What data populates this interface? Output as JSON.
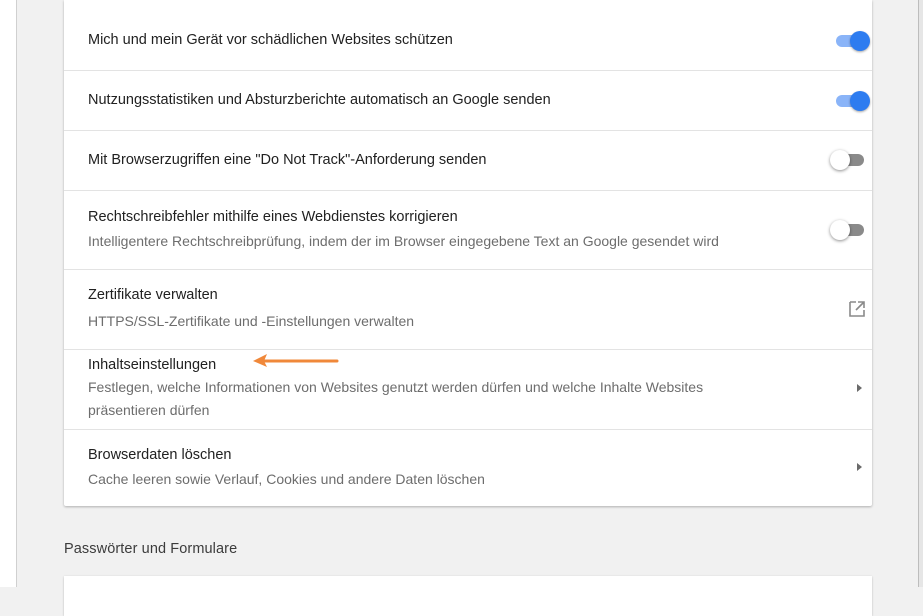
{
  "settings": {
    "rows": [
      {
        "title": "Mich und mein Gerät vor schädlichen Websites schützen",
        "toggle": "on"
      },
      {
        "title": "Nutzungsstatistiken und Absturzberichte automatisch an Google senden",
        "toggle": "on"
      },
      {
        "title": "Mit Browserzugriffen eine \"Do Not Track\"-Anforderung senden",
        "toggle": "off"
      },
      {
        "title": "Rechtschreibfehler mithilfe eines Webdienstes korrigieren",
        "subtitle": "Intelligentere Rechtschreibprüfung, indem der im Browser eingegebene Text an Google gesendet wird",
        "toggle": "off"
      },
      {
        "title": "Zertifikate verwalten",
        "subtitle": "HTTPS/SSL-Zertifikate und -Einstellungen verwalten",
        "icon": "open-in-new-icon"
      },
      {
        "title": "Inhaltseinstellungen",
        "subtitle_line1": "Festlegen, welche Informationen von Websites genutzt werden dürfen und welche Inhalte Websites",
        "subtitle_line2": "präsentieren dürfen",
        "icon": "chevron-right-icon"
      },
      {
        "title": "Browserdaten löschen",
        "subtitle": "Cache leeren sowie Verlauf, Cookies und andere Daten löschen",
        "icon": "chevron-right-icon"
      }
    ]
  },
  "sections": {
    "passwords_heading": "Passwörter und Formulare"
  },
  "annotation": {
    "arrow_icon": "arrow-left-icon",
    "arrow_color": "#f0883a"
  },
  "colors": {
    "toggle_on_knob": "#2d7cf0",
    "toggle_on_track": "#8ab4f8",
    "toggle_off_track": "#8a8a8a"
  }
}
